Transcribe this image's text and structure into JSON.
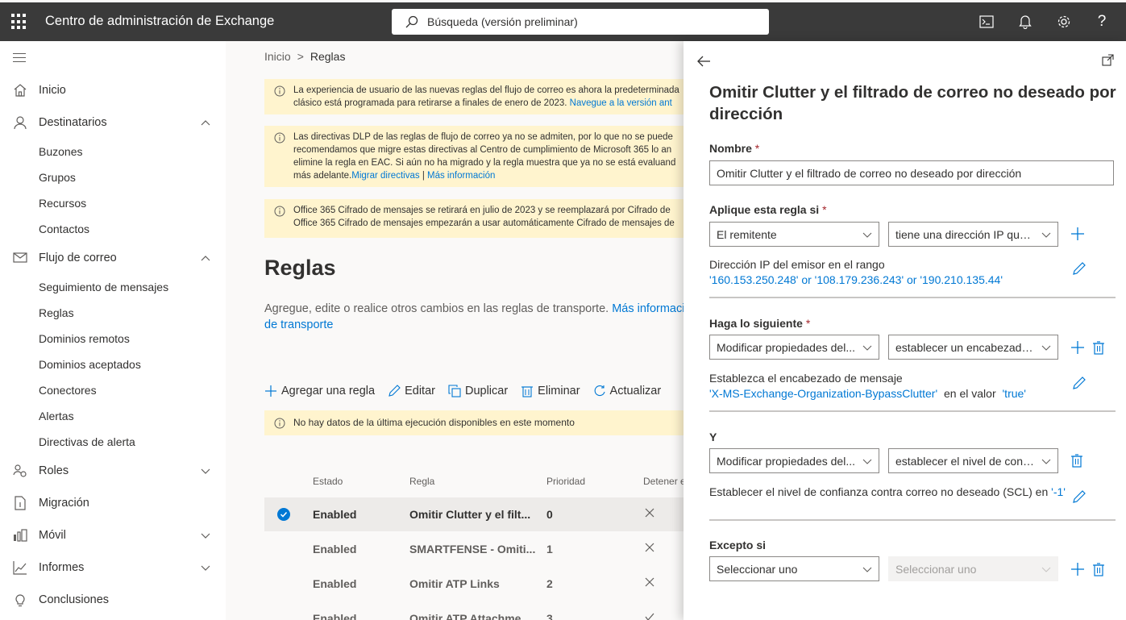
{
  "topbar": {
    "app_title": "Centro de administración de Exchange",
    "search_placeholder": "Búsqueda (versión preliminar)",
    "help_label": "?"
  },
  "nav": {
    "inicio": "Inicio",
    "destinatarios": "Destinatarios",
    "buzones": "Buzones",
    "grupos": "Grupos",
    "recursos": "Recursos",
    "contactos": "Contactos",
    "flujo": "Flujo de correo",
    "seguimiento": "Seguimiento de mensajes",
    "reglas": "Reglas",
    "dominios_remotos": "Dominios remotos",
    "dominios_aceptados": "Dominios aceptados",
    "conectores": "Conectores",
    "alertas": "Alertas",
    "directivas_alerta": "Directivas de alerta",
    "roles": "Roles",
    "migracion": "Migración",
    "movil": "Móvil",
    "informes": "Informes",
    "conclusiones": "Conclusiones"
  },
  "main": {
    "breadcrumb": {
      "home": "Inicio",
      "sep": ">",
      "current": "Reglas"
    },
    "notice1": {
      "line1": "La experiencia de usuario de las nuevas reglas del flujo de correo es ahora la predeterminada",
      "line2": "clásico está programada para retirarse a finales de enero de 2023.",
      "link": "Navegue a la versión ant"
    },
    "notice2": {
      "line1": "Las directivas DLP de las reglas de flujo de correo ya no se admiten, por lo que no se puede",
      "line2": "recomendamos que migre estas directivas al Centro de cumplimiento de Microsoft 365 lo an",
      "line3": "elimine la regla en EAC. Si aún no ha migrado y la regla muestra que ya no se está evaluand",
      "line4": "más adelante.",
      "link1": "Migrar directivas",
      "sep": "|",
      "link2": "Más información"
    },
    "notice3": {
      "line1": "Office 365 Cifrado de mensajes se retirará en julio de 2023 y se reemplazará por Cifrado de",
      "line2": "Office 365 Cifrado de mensajes empezarán a usar automáticamente Cifrado de mensajes de"
    },
    "title": "Reglas",
    "description": "Agregue, edite o realice otros cambios en las reglas de transporte.",
    "desc_link1": "Más información s",
    "desc_link2": "de transporte",
    "commands": {
      "add": "Agregar una regla",
      "edit": "Editar",
      "duplicate": "Duplicar",
      "delete": "Eliminar",
      "refresh": "Actualizar"
    },
    "empty_notice": "No hay datos de la última ejecución disponibles en este momento",
    "table": {
      "headers": {
        "status": "Estado",
        "rule": "Regla",
        "priority": "Prioridad",
        "stop": "Detener e"
      },
      "rows": [
        {
          "status": "Enabled",
          "rule": "Omitir Clutter y el filt...",
          "priority": "0"
        },
        {
          "status": "Enabled",
          "rule": "SMARTFENSE - Omiti...",
          "priority": "1"
        },
        {
          "status": "Enabled",
          "rule": "Omitir ATP Links",
          "priority": "2"
        },
        {
          "status": "Enabled",
          "rule": "Omitir ATP Attachme...",
          "priority": "3"
        }
      ]
    }
  },
  "panel": {
    "title": "Omitir Clutter y el filtrado de correo no deseado por dirección",
    "name_label": "Nombre",
    "required_mark": "*",
    "name_value": "Omitir Clutter y el filtrado de correo no deseado por dirección",
    "apply_label": "Aplique esta regla si",
    "apply_dd1": "El remitente",
    "apply_dd2": "tiene una dirección IP que...",
    "ip_label": "Dirección IP del emisor en el rango",
    "ip_value": "'160.153.250.248' or '108.179.236.243' or '190.210.135.44'",
    "do_label": "Haga lo siguiente",
    "do_dd1": "Modificar propiedades del...",
    "do_dd2": "establecer un encabezado...",
    "header_label": "Establezca el encabezado de mensaje",
    "header_value": "'X-MS-Exchange-Organization-BypassClutter'",
    "header_mid": "en el valor",
    "header_val2": "'true'",
    "and_label": "Y",
    "and_dd1": "Modificar propiedades del...",
    "and_dd2": "establecer el nivel de conf...",
    "scl_label": "Establecer el nivel de confianza contra correo no deseado (SCL) en",
    "scl_value": "'-1'",
    "except_label": "Excepto si",
    "except_dd1": "Seleccionar uno",
    "except_dd2": "Seleccionar uno"
  }
}
